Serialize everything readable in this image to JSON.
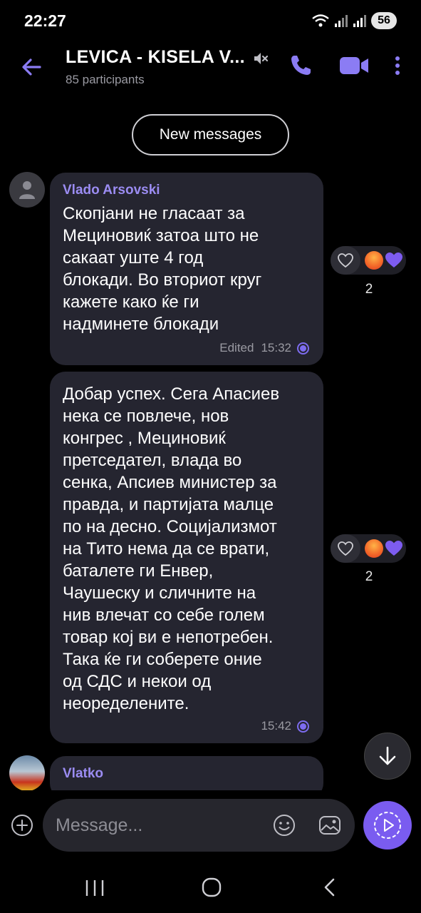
{
  "status": {
    "time": "22:27",
    "battery": "56",
    "icons": [
      "wifi-icon",
      "signal-icon",
      "signal-icon",
      "battery-icon"
    ]
  },
  "header": {
    "title": "LEVICA - KISELA V...",
    "subtitle": "85 participants",
    "icons": [
      "back-arrow-icon",
      "muted-speaker-icon",
      "phone-icon",
      "video-camera-icon",
      "more-vertical-icon"
    ]
  },
  "new_messages_label": "New messages",
  "messages": [
    {
      "sender": "Vlado Arsovski",
      "text": "Скопјани не гласаат за\nМециновиќ затоа што не\nсакаат уште 4 год\nблокади. Во вториот круг\nкажете како ќе ги\nнадминете блокади",
      "edited": "Edited",
      "time": "15:32",
      "reaction_count": "2",
      "reactions": [
        "angry-face-emoji",
        "purple-heart-emoji"
      ]
    },
    {
      "sender": "",
      "text": "Добар успех. Сега Апасиев\nнека се повлече, нов\nконгрес , Мециновиќ\nпретседател, влада во\nсенка, Апсиев министер за\nправда, и партијата малце\nпо на десно. Социјализмот\nна Тито нема да се врати,\nбаталете ги Енвер,\nЧаушеску  и сличните на\nнив влечат со себе голем\nтовар кој ви е непотребен.\nТака ќе ги соберете оние\nод СДС и некои од\nнеоределените.",
      "time": "15:42",
      "reaction_count": "2",
      "reactions": [
        "angry-face-emoji",
        "purple-heart-emoji"
      ]
    },
    {
      "sender": "Vlatko",
      "text": ""
    }
  ],
  "composer": {
    "placeholder": "Message..."
  },
  "colors": {
    "background": "#000000",
    "bubble": "#252530",
    "accent": "#7a5cf0",
    "sender_name": "#9b8cf2"
  }
}
